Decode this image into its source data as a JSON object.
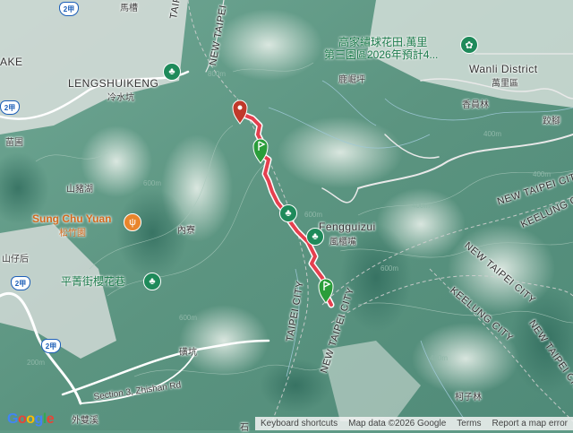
{
  "map": {
    "place_labels": [
      {
        "name": "lengshuikeng",
        "text": "LENGSHUIKENG"
      },
      {
        "name": "lengshuikeng-zh",
        "text": "冷水坑"
      },
      {
        "name": "wanli",
        "text": "Wanli District"
      },
      {
        "name": "wanli-zh",
        "text": "萬里區"
      },
      {
        "name": "fengguizui",
        "text": "Fengguizui"
      },
      {
        "name": "fengguizui-zh",
        "text": "風櫃嘴"
      },
      {
        "name": "ake",
        "text": "AKE"
      },
      {
        "name": "machao",
        "text": "馬槽"
      },
      {
        "name": "lukuping",
        "text": "鹿崛坪"
      },
      {
        "name": "xiangyuanlin",
        "text": "香員林"
      },
      {
        "name": "bojiao",
        "text": "跤腳"
      },
      {
        "name": "miaopu",
        "text": "苗圃"
      },
      {
        "name": "shanzhuhu",
        "text": "山豬湖"
      },
      {
        "name": "neiliao",
        "text": "內寮"
      },
      {
        "name": "shanzihou",
        "text": "山仔后"
      },
      {
        "name": "jikeng",
        "text": "磺坑"
      },
      {
        "name": "waishuangxi",
        "text": "外雙溪"
      },
      {
        "name": "kezilin",
        "text": "柯子林"
      },
      {
        "name": "shi",
        "text": "石"
      }
    ],
    "poi_labels": [
      {
        "name": "hydrangea-1",
        "text": "高家繡球花田.萬里"
      },
      {
        "name": "hydrangea-2",
        "text": "第三園區2026年預計4..."
      },
      {
        "name": "sungchuyuan",
        "text": "Sung Chu Yuan"
      },
      {
        "name": "sungchuyuan-zh",
        "text": "松竹園"
      },
      {
        "name": "pingjing",
        "text": "平菁街櫻花巷"
      }
    ],
    "road_labels": [
      {
        "name": "new-taipei-top",
        "text": "NEW TAIPEI"
      },
      {
        "name": "taipei-top",
        "text": "TAIPEI"
      },
      {
        "name": "new-taipei-city-1",
        "text": "NEW TAIPEI CITY"
      },
      {
        "name": "taipei-city",
        "text": "TAIPEI CITY"
      },
      {
        "name": "new-taipei-city-2",
        "text": "NEW TAIPEI CITY"
      },
      {
        "name": "keelung-city-1",
        "text": "KEELUNG CITY"
      },
      {
        "name": "new-taipei-city-3",
        "text": "NEW TAIPEI CITY"
      },
      {
        "name": "keelung-city-2",
        "text": "KEELUNG CITY"
      },
      {
        "name": "new-taipei-city-4",
        "text": "NEW TAIPEI CITY"
      },
      {
        "name": "zhishan-rd",
        "text": "Section 3, Zhishan Rd"
      }
    ],
    "route_shields": [
      "2甲",
      "2甲",
      "2甲",
      "2甲"
    ],
    "elevation_labels": [
      "800m",
      "600m",
      "400m",
      "600m",
      "400m",
      "600m",
      "400m",
      "200m",
      "400m",
      "600m"
    ],
    "footer": {
      "shortcuts": "Keyboard shortcuts",
      "data": "Map data ©2026 Google",
      "terms": "Terms",
      "report": "Report a map error"
    },
    "logo": "Google",
    "colors": {
      "route": "#e5404f",
      "marker_start": "#2a9d3a",
      "marker_end": "#c0392b",
      "poi": "#1e8a5a"
    }
  }
}
